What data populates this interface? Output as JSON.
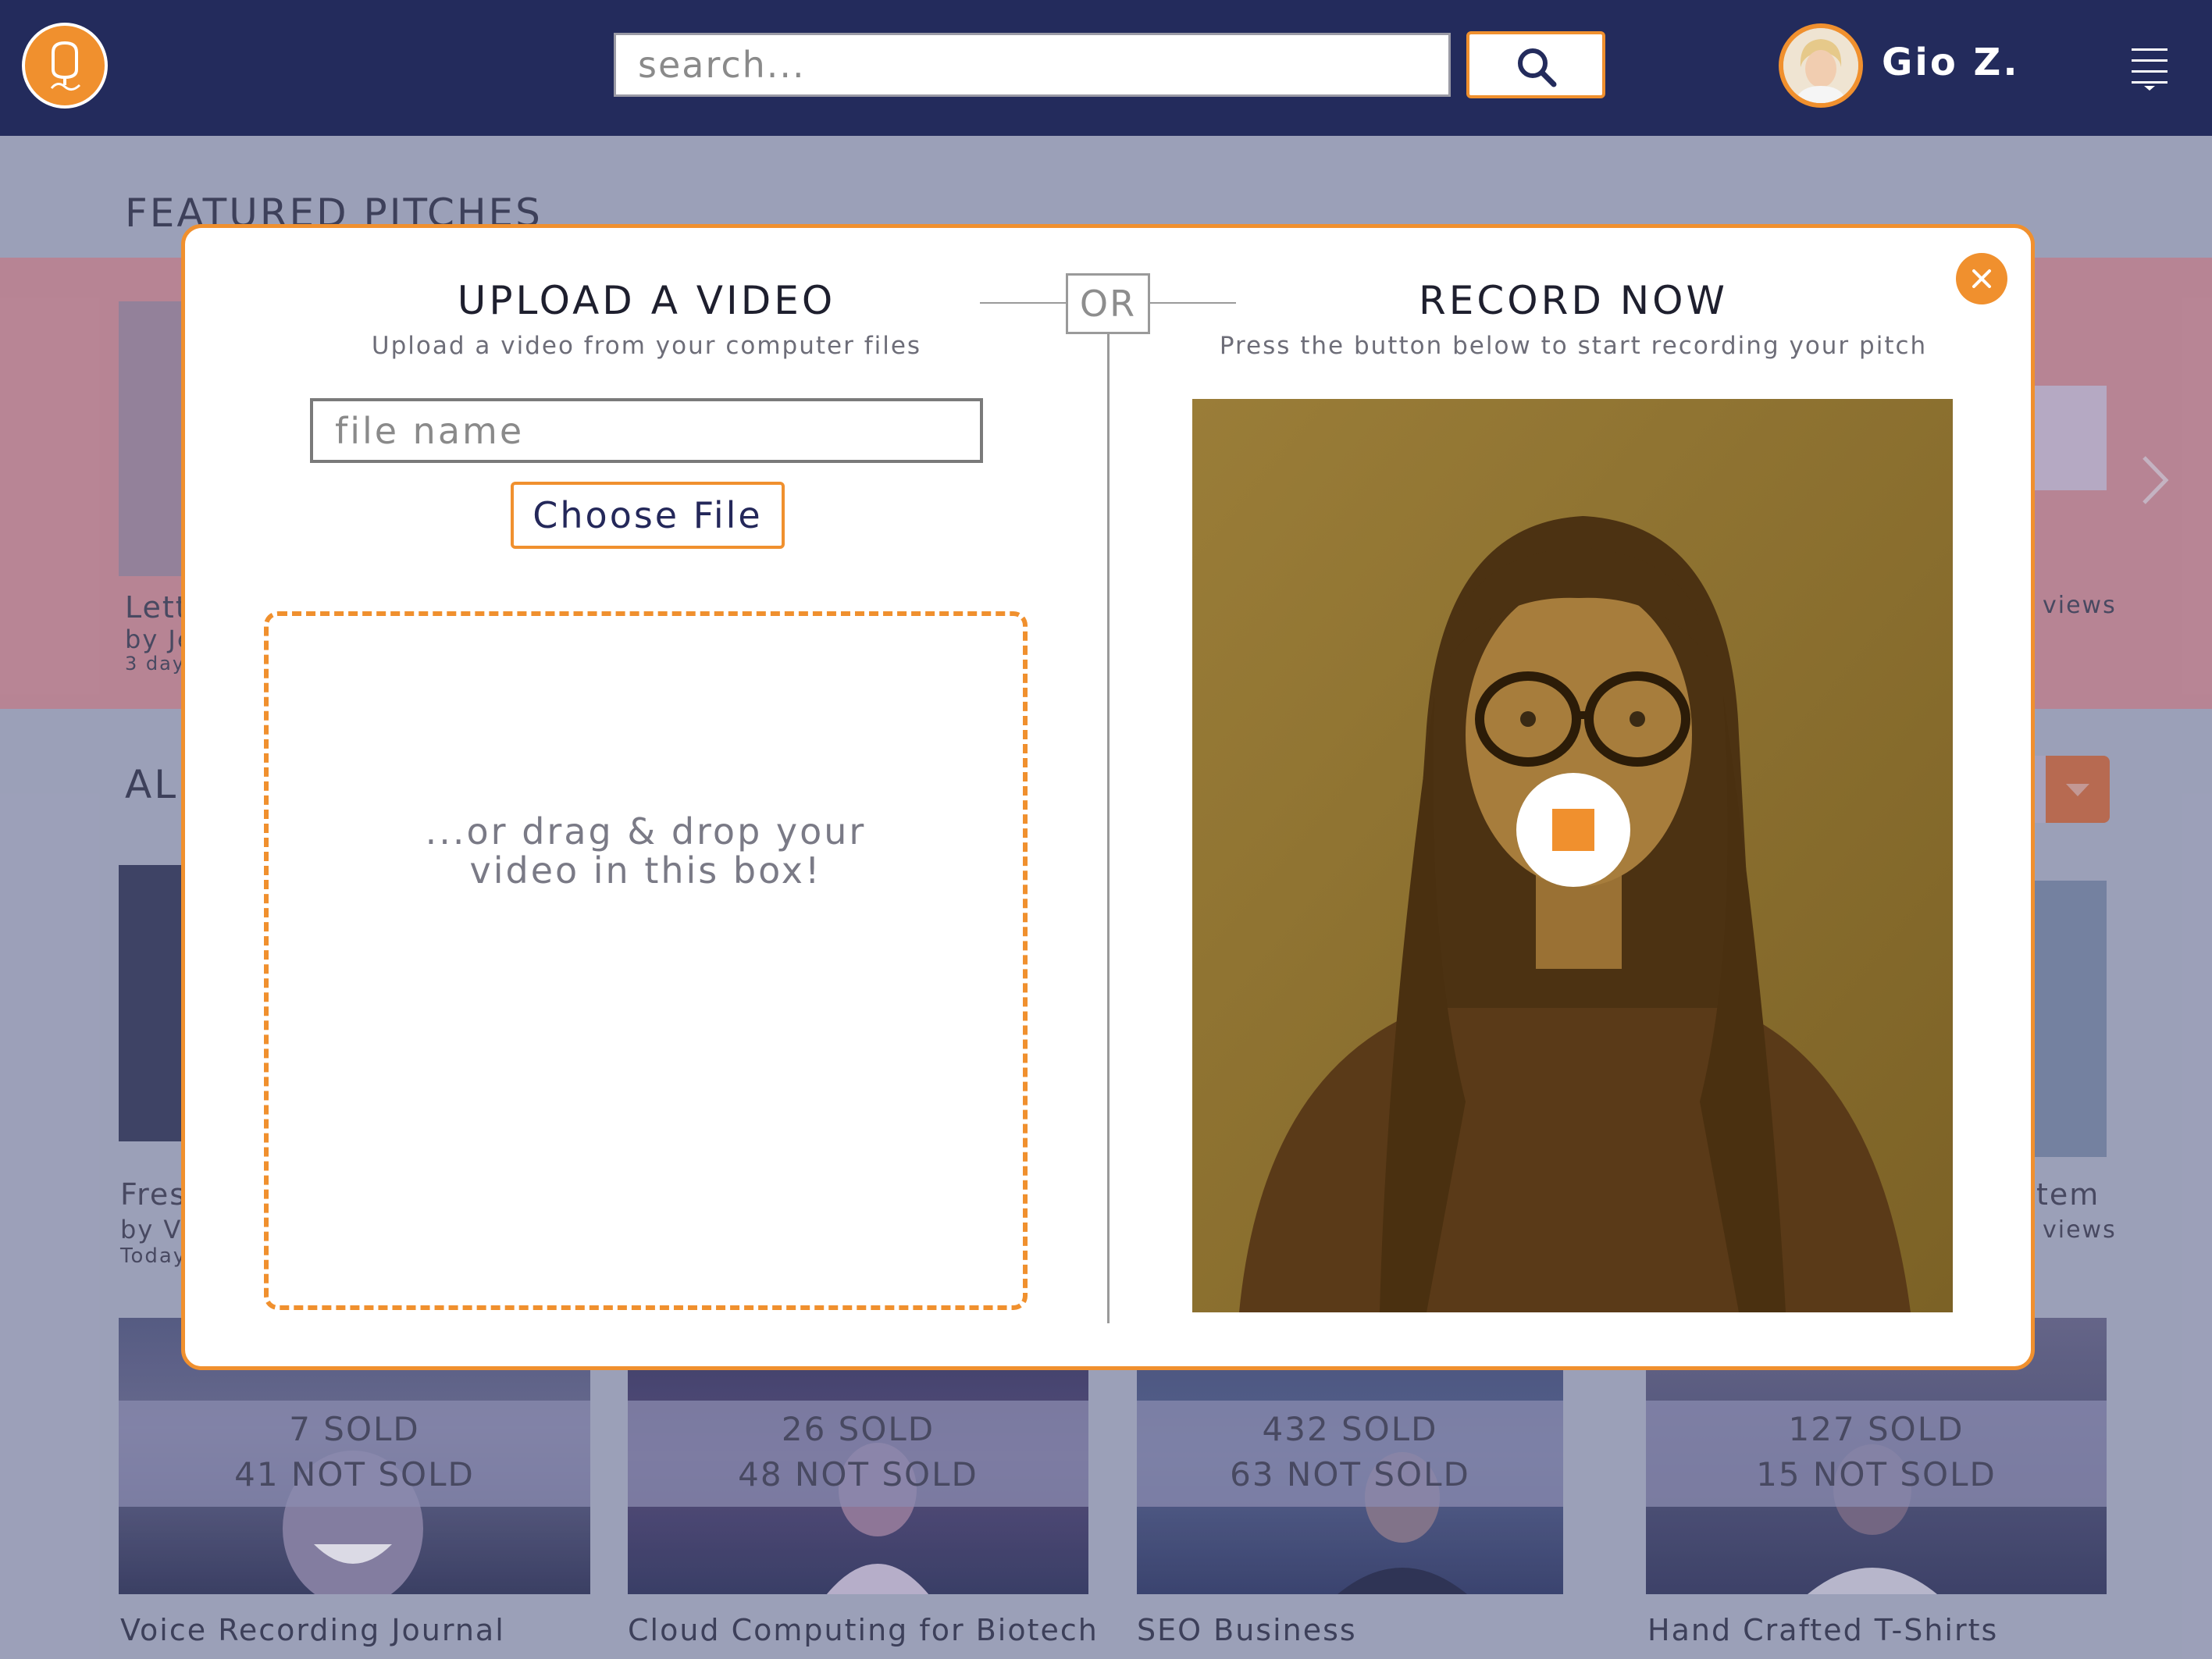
{
  "header": {
    "search_placeholder": "search...",
    "user_name": "Gio Z."
  },
  "background": {
    "featured_title": "FEATURED PITCHES",
    "all_title": "ALL",
    "featured_card_title_fragment": "Lett",
    "featured_card_by_fragment": "by Je",
    "featured_card_time_fragment": "3 day",
    "featured_views": "views",
    "row2_title_fragment": "Fres",
    "row2_by_fragment": "by Vi",
    "row2_time_fragment": "Today",
    "row2_right_title_fragment": "tem",
    "row2_right_views": "views",
    "cards": [
      {
        "sold": "7 SOLD",
        "not_sold": "41 NOT SOLD",
        "title": "Voice Recording Journal"
      },
      {
        "sold": "26 SOLD",
        "not_sold": "48 NOT SOLD",
        "title": "Cloud Computing for Biotech"
      },
      {
        "sold": "432 SOLD",
        "not_sold": "63 NOT SOLD",
        "title": "SEO Business"
      },
      {
        "sold": "127 SOLD",
        "not_sold": "15 NOT SOLD",
        "title": "Hand Crafted T-Shirts"
      }
    ]
  },
  "modal": {
    "upload": {
      "title": "UPLOAD A VIDEO",
      "subtitle": "Upload a video from your computer files",
      "file_placeholder": "file name",
      "choose_label": "Choose File",
      "drop_line1": "...or drag & drop your",
      "drop_line2": "video in this box!"
    },
    "or_label": "OR",
    "record": {
      "title": "RECORD NOW",
      "subtitle": "Press the button below to start recording your pitch"
    }
  },
  "colors": {
    "accent": "#f0902e",
    "header_bg": "#232b5c",
    "page_bg": "#a9adc3",
    "featured_band": "#c98e9a"
  },
  "icons": {
    "logo": "q-logo-icon",
    "search": "magnifier-icon",
    "menu": "hamburger-menu-icon",
    "close": "close-x-icon",
    "record": "stop-square-icon",
    "next": "chevron-right-icon",
    "sort": "caret-down-icon"
  }
}
